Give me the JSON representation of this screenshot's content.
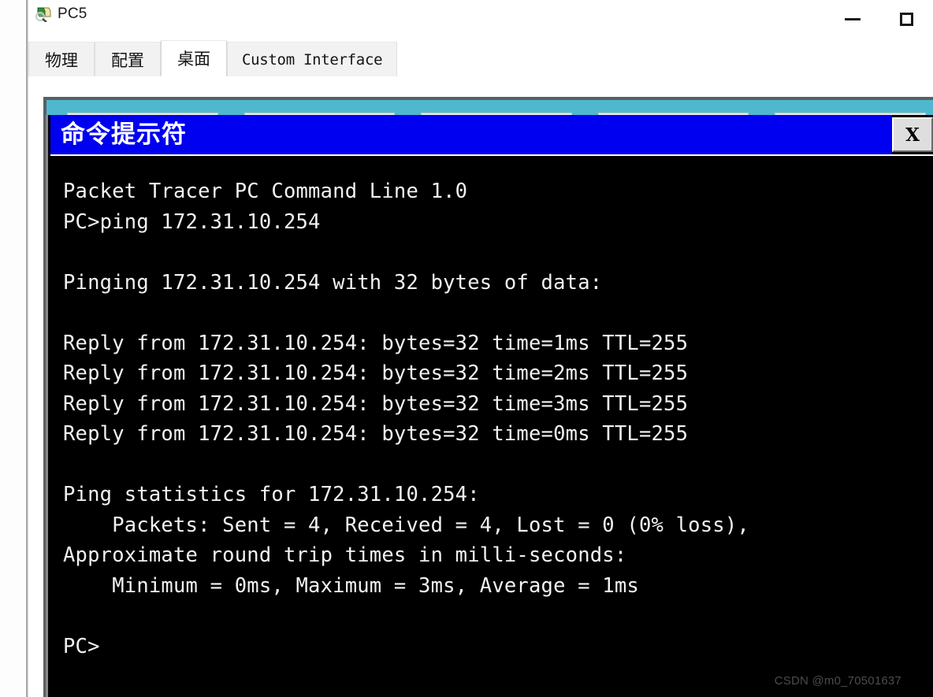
{
  "window": {
    "title": "PC5",
    "icon": "pc-device-icon",
    "controls": {
      "minimize_label": "—",
      "maximize_label": "□"
    }
  },
  "tabs": [
    {
      "label": "物理",
      "name": "tab-physical",
      "active": false,
      "cjk": true
    },
    {
      "label": "配置",
      "name": "tab-config",
      "active": false,
      "cjk": true
    },
    {
      "label": "桌面",
      "name": "tab-desktop",
      "active": true,
      "cjk": true
    },
    {
      "label": "Custom Interface",
      "name": "tab-custom-interface",
      "active": false,
      "wide": true
    }
  ],
  "desktop": {
    "background_color": "#4fb8cf",
    "icon_count": 5
  },
  "cmd": {
    "title": "命令提示符",
    "titlebar_color": "#0000f0",
    "close_label": "X",
    "text_color": "#f2f2f2",
    "background_color": "#000000",
    "lines": [
      "Packet Tracer PC Command Line 1.0",
      "PC>ping 172.31.10.254",
      "",
      "Pinging 172.31.10.254 with 32 bytes of data:",
      "",
      "Reply from 172.31.10.254: bytes=32 time=1ms TTL=255",
      "Reply from 172.31.10.254: bytes=32 time=2ms TTL=255",
      "Reply from 172.31.10.254: bytes=32 time=3ms TTL=255",
      "Reply from 172.31.10.254: bytes=32 time=0ms TTL=255",
      "",
      "Ping statistics for 172.31.10.254:",
      "    Packets: Sent = 4, Received = 4, Lost = 0 (0% loss),",
      "Approximate round trip times in milli-seconds:",
      "    Minimum = 0ms, Maximum = 3ms, Average = 1ms",
      "",
      "PC>"
    ]
  },
  "watermark": {
    "text": "CSDN @m0_70501637"
  }
}
